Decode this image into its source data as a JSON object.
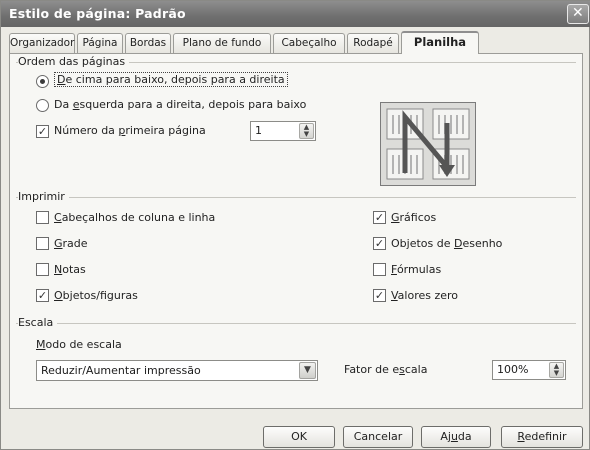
{
  "window": {
    "title": "Estilo de página: Padrão",
    "close_glyph": "✕"
  },
  "tabs": [
    {
      "label": "Organizador"
    },
    {
      "label": "Página"
    },
    {
      "label": "Bordas"
    },
    {
      "label": "Plano de fundo"
    },
    {
      "label": "Cabeçalho"
    },
    {
      "label": "Rodapé"
    },
    {
      "label": "Planilha"
    }
  ],
  "active_tab": "Planilha",
  "page_order": {
    "group_label": "Ordem das páginas",
    "option_top_bottom": {
      "pre": "",
      "acc": "D",
      "post": "e cima para baixo, depois para a direita",
      "selected": true
    },
    "option_left_right": {
      "pre": "Da ",
      "acc": "e",
      "post": "squerda para a direita, depois para baixo",
      "selected": false
    },
    "first_page_number": {
      "pre": "Número da ",
      "acc": "p",
      "post": "rimeira página",
      "checked": true,
      "value": "1"
    }
  },
  "print": {
    "group_label": "Imprimir",
    "left": [
      {
        "pre": "",
        "acc": "C",
        "post": "abeçalhos de coluna e linha",
        "checked": false
      },
      {
        "pre": "",
        "acc": "G",
        "post": "rade",
        "checked": false
      },
      {
        "pre": "",
        "acc": "N",
        "post": "otas",
        "checked": false
      },
      {
        "pre": "",
        "acc": "O",
        "post": "bjetos/figuras",
        "checked": true
      }
    ],
    "right": [
      {
        "pre": "",
        "acc": "G",
        "post": "ráficos",
        "checked": true
      },
      {
        "pre": "Objetos de ",
        "acc": "D",
        "post": "esenho",
        "checked": true
      },
      {
        "pre": "",
        "acc": "F",
        "post": "órmulas",
        "checked": false
      },
      {
        "pre": "",
        "acc": "V",
        "post": "alores zero",
        "checked": true
      }
    ]
  },
  "scale": {
    "group_label": "Escala",
    "mode_label_acc": "M",
    "mode_label_post": "odo de escala",
    "mode_value": "Reduzir/Aumentar impressão",
    "factor_label_pre": "Fator de e",
    "factor_label_acc": "s",
    "factor_label_post": "cala",
    "factor_value": "100%"
  },
  "buttons": {
    "ok": "OK",
    "cancel": "Cancelar",
    "help_pre": "Aj",
    "help_acc": "u",
    "help_post": "da",
    "reset_acc": "R",
    "reset_post": "edefinir"
  },
  "icons": {
    "check": "✓",
    "spin_up": "▲",
    "spin_down": "▼",
    "dropdown": "▼"
  },
  "colors": {
    "titlebar": "#7a7a7a",
    "panel": "#f7f7f4"
  }
}
